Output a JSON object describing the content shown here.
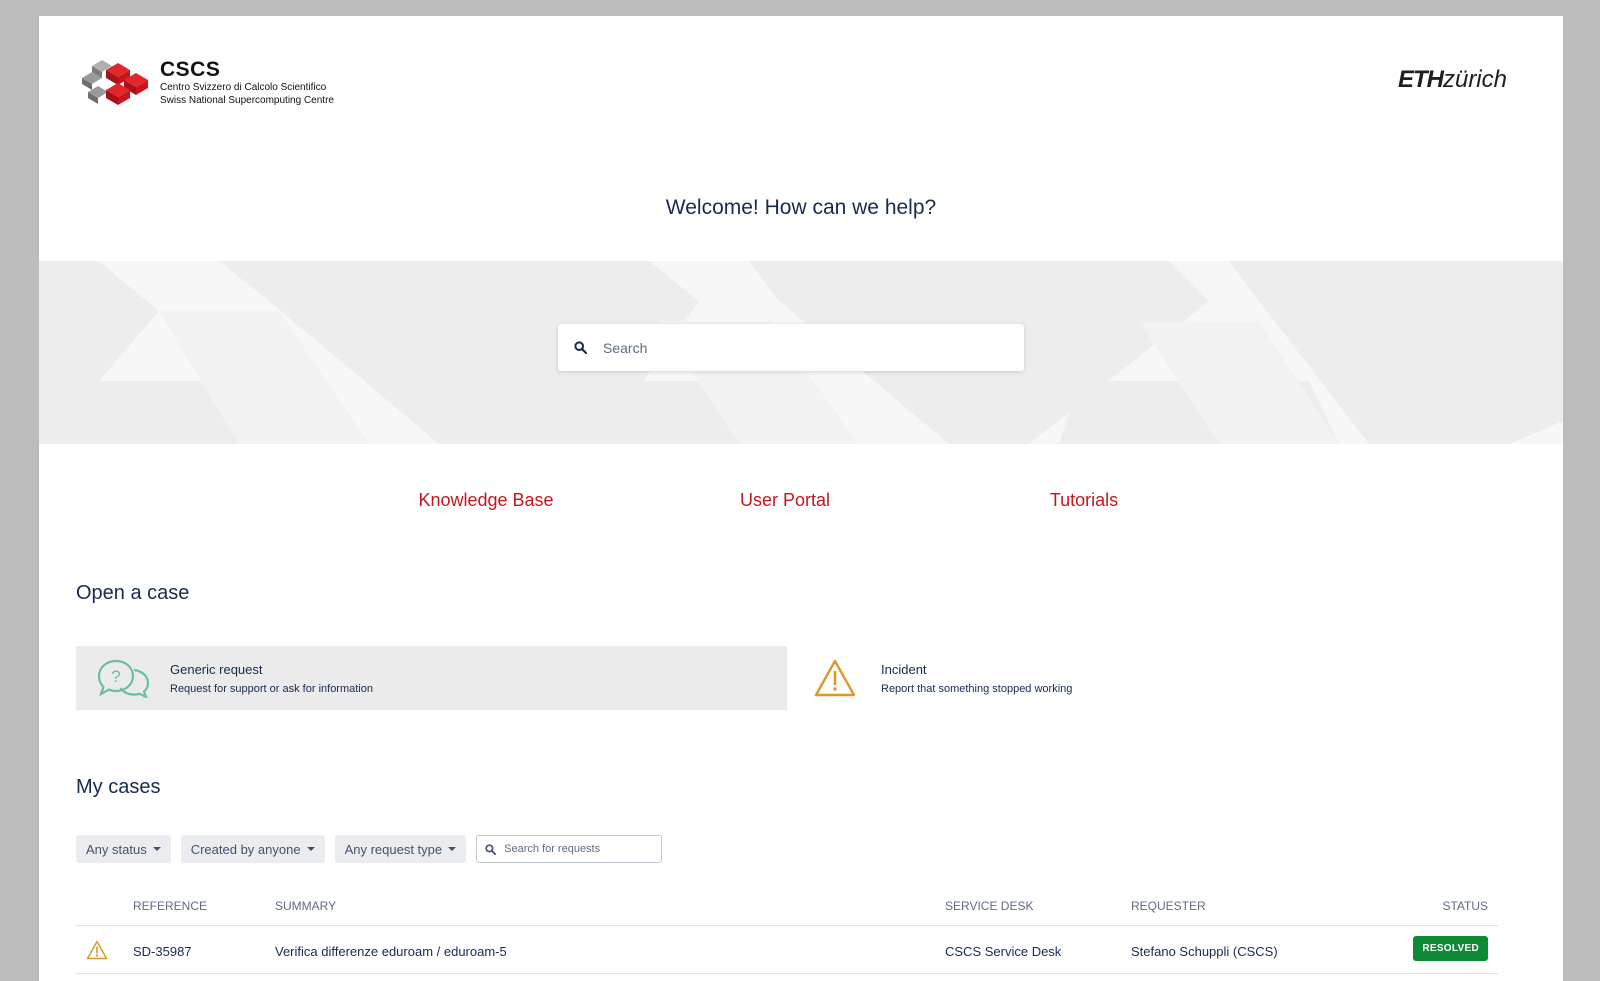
{
  "header": {
    "brand_name": "CSCS",
    "brand_line1": "Centro Svizzero di Calcolo Scientifico",
    "brand_line2": "Swiss National Supercomputing Centre",
    "partner_bold": "ETH",
    "partner_rest": "zürich"
  },
  "hero": {
    "welcome": "Welcome! How can we help?",
    "search_placeholder": "Search"
  },
  "quick_links": [
    {
      "label": "Knowledge Base"
    },
    {
      "label": "User Portal"
    },
    {
      "label": "Tutorials"
    }
  ],
  "open_case": {
    "title": "Open a case",
    "types": [
      {
        "title": "Generic request",
        "description": "Request for support or ask for information",
        "icon": "question-bubbles-icon"
      },
      {
        "title": "Incident",
        "description": "Report that something stopped working",
        "icon": "warning-icon"
      }
    ]
  },
  "my_cases": {
    "title": "My cases",
    "filters": {
      "status": "Any status",
      "created_by": "Created by anyone",
      "request_type": "Any request type",
      "search_placeholder": "Search for requests"
    },
    "columns": {
      "reference": "REFERENCE",
      "summary": "SUMMARY",
      "service_desk": "SERVICE DESK",
      "requester": "REQUESTER",
      "status": "STATUS"
    },
    "rows": [
      {
        "type_icon": "warning-icon",
        "reference": "SD-35987",
        "summary": "Verifica differenze eduroam / eduroam-5",
        "service_desk": "CSCS Service Desk",
        "requester": "Stefano Schuppli (CSCS)",
        "status": "RESOLVED"
      }
    ]
  },
  "colors": {
    "accent_red": "#c5161d",
    "heading_navy": "#172b4d",
    "resolved_green": "#0e8a36",
    "generic_icon_green": "#6bbf9a",
    "incident_icon_orange": "#d99a2b"
  }
}
